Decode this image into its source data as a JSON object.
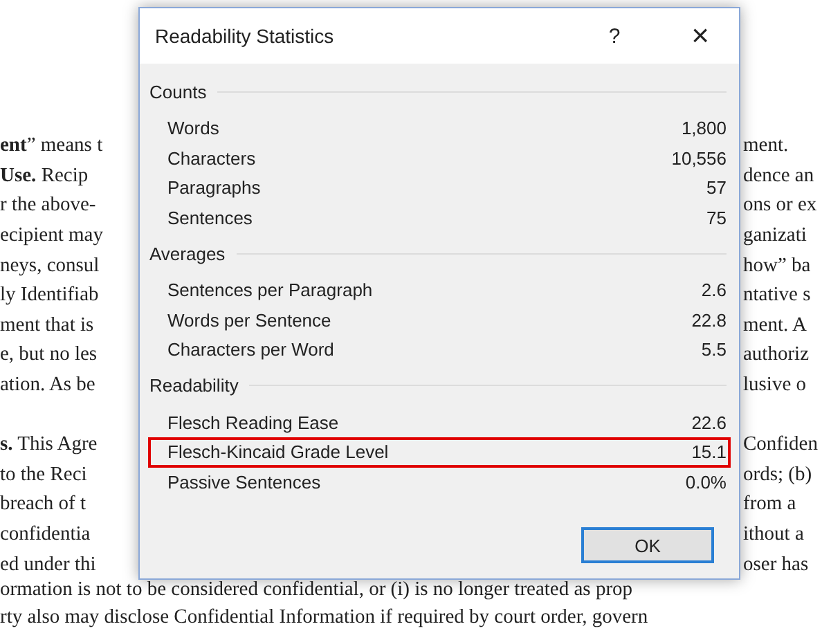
{
  "document": {
    "paragraphs": [
      {
        "lines": [
          {
            "left": "**ent**” means t",
            "right": "ment."
          },
          {
            "left": "**Use.** Recip",
            "right": "dence an"
          },
          {
            "left": "r the above-",
            "right": "ons or ex"
          },
          {
            "left": "ecipient may",
            "right": "ganizati"
          },
          {
            "left": "neys, consul",
            "right": "how” ba"
          },
          {
            "left": "ly Identifiab",
            "right": "ntative s"
          },
          {
            "left": "ment that is",
            "right": "ment. A"
          },
          {
            "left": "e, but no les",
            "right": "authoriz"
          },
          {
            "left": "ation. As be",
            "right": "lusive o"
          }
        ]
      },
      {
        "lines": [
          {
            "left": "**s.** This Agre",
            "right": "Confiden"
          },
          {
            "left": "to the Reci",
            "right": "ords; (b)"
          },
          {
            "left": "breach of t",
            "right": "from a"
          },
          {
            "left": "confidentia",
            "right": "ithout a"
          },
          {
            "left": "ed under thi",
            "right": "oser has"
          }
        ]
      }
    ],
    "full_lines": [
      "ormation is not to be considered confidential, or (i) is no longer treated as prop",
      "rty also may disclose Confidential Information if required by court order, govern"
    ]
  },
  "dialog": {
    "title": "Readability Statistics",
    "help": "?",
    "close": "×",
    "sections": [
      {
        "title": "Counts",
        "rows": [
          {
            "label": "Words",
            "value": "1,800",
            "highlighted": false
          },
          {
            "label": "Characters",
            "value": "10,556",
            "highlighted": false
          },
          {
            "label": "Paragraphs",
            "value": "57",
            "highlighted": false
          },
          {
            "label": "Sentences",
            "value": "75",
            "highlighted": false
          }
        ]
      },
      {
        "title": "Averages",
        "rows": [
          {
            "label": "Sentences per Paragraph",
            "value": "2.6",
            "highlighted": false
          },
          {
            "label": "Words per Sentence",
            "value": "22.8",
            "highlighted": false
          },
          {
            "label": "Characters per Word",
            "value": "5.5",
            "highlighted": false
          }
        ]
      },
      {
        "title": "Readability",
        "rows": [
          {
            "label": "Flesch Reading Ease",
            "value": "22.6",
            "highlighted": false
          },
          {
            "label": "Flesch-Kincaid Grade Level",
            "value": "15.1",
            "highlighted": true
          },
          {
            "label": "Passive Sentences",
            "value": "0.0%",
            "highlighted": false
          }
        ]
      }
    ],
    "ok_button": "OK"
  }
}
